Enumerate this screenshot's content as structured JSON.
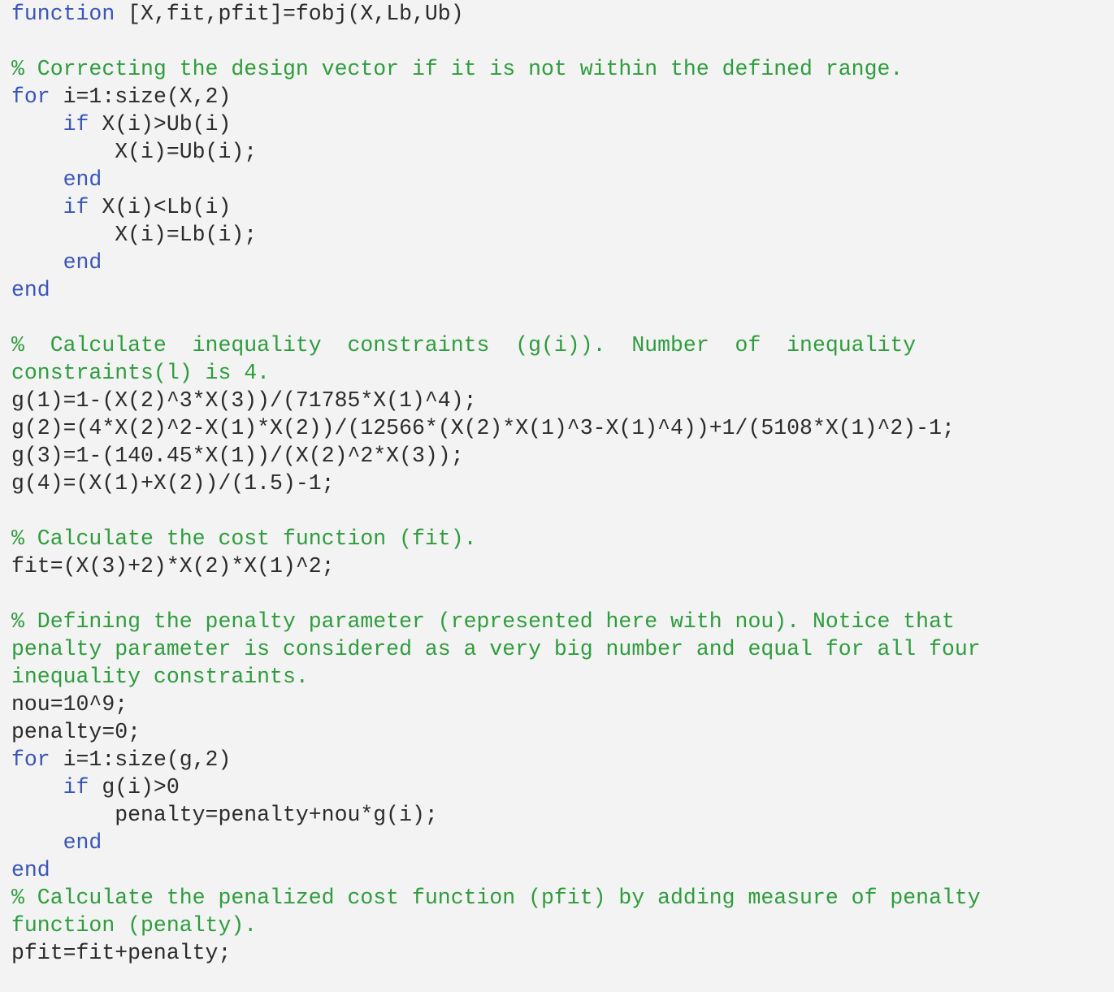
{
  "editor": {
    "language": "MATLAB",
    "background_color": "#f2f3f2",
    "keyword_color": "#3a55b8",
    "comment_color": "#2f9c3e",
    "code_color": "#2b2b2b"
  },
  "lines": {
    "l01_kw": "function",
    "l01_rest": " [X,fit,pfit]=fobj(X,Lb,Ub)",
    "l02_blank": " ",
    "l03_comment": "% Correcting the design vector if it is not within the defined range.",
    "l04_kw": "for",
    "l04_rest": " i=1:size(X,2)",
    "l05_kw": "    if",
    "l05_rest": " X(i)>Ub(i)",
    "l06_code": "        X(i)=Ub(i);",
    "l07_kw": "    end",
    "l08_kw": "    if",
    "l08_rest": " X(i)<Lb(i)",
    "l09_code": "        X(i)=Lb(i);",
    "l10_kw": "    end",
    "l11_kw": "end",
    "l12_blank": " ",
    "l13_comment_p1": "%  Calculate  inequality  constraints  (g(i)).  Number  of  inequality",
    "l13_comment_p2": "constraints(l) is 4.",
    "l14_code": "g(1)=1-(X(2)^3*X(3))/(71785*X(1)^4);",
    "l15_code": "g(2)=(4*X(2)^2-X(1)*X(2))/(12566*(X(2)*X(1)^3-X(1)^4))+1/(5108*X(1)^2)-1;",
    "l16_code": "g(3)=1-(140.45*X(1))/(X(2)^2*X(3));",
    "l17_code": "g(4)=(X(1)+X(2))/(1.5)-1;",
    "l18_blank": " ",
    "l19_comment": "% Calculate the cost function (fit).",
    "l20_code": "fit=(X(3)+2)*X(2)*X(1)^2;",
    "l21_blank": " ",
    "l22_comment_p1": "% Defining the penalty parameter (represented here with nou). Notice that",
    "l22_comment_p2": "penalty parameter is considered as a very big number and equal for all four",
    "l22_comment_p3": "inequality constraints.",
    "l23_code": "nou=10^9;",
    "l24_code": "penalty=0;",
    "l25_kw": "for",
    "l25_rest": " i=1:size(g,2)",
    "l26_kw": "    if",
    "l26_rest": " g(i)>0",
    "l27_code": "        penalty=penalty+nou*g(i);",
    "l28_kw": "    end",
    "l29_kw": "end",
    "l30_comment_p1": "% Calculate the penalized cost function (pfit) by adding measure of penalty",
    "l30_comment_p2": "function (penalty).",
    "l31_code": "pfit=fit+penalty;"
  }
}
